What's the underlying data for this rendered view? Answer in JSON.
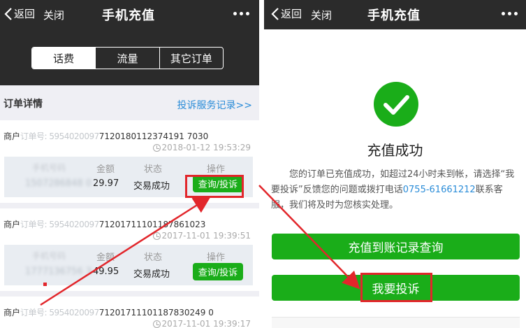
{
  "left": {
    "nav": {
      "back": "返回",
      "close": "关闭",
      "title": "手机充值"
    },
    "tabs": [
      "话费",
      "流量",
      "其它订单"
    ],
    "section": {
      "title": "订单详情",
      "link": "投诉服务记录>>"
    },
    "headers": {
      "phone": "手机号码",
      "amount": "金额",
      "status": "状态",
      "op": "操作"
    },
    "orders": [
      {
        "merchant_label": "商户",
        "merchant_masked": "订单号:  5954020097",
        "order_suffix": "712018011237419170 30",
        "order_no_visible": "7120180112374191 7030",
        "time": "2018-01-12 19:53:29",
        "phone_masked": "1507286848 0",
        "amount": "29.97",
        "status": "交易成功",
        "action": "查询/投诉"
      },
      {
        "merchant_label": "商户",
        "merchant_masked": "订单号:  5954020097",
        "order_no_visible": "71201711101187861023",
        "time": "2017-11-01 19:39:51",
        "phone_masked": "1777136756 3",
        "amount": "49.95",
        "status": "交易成功",
        "action": "查询/投诉"
      },
      {
        "merchant_label": "商户",
        "merchant_masked": "订单号:  5954020097",
        "order_no_visible": "71201711101187830249 0",
        "time": "2017-11-01 19:39:17"
      }
    ]
  },
  "right": {
    "nav": {
      "back": "返回",
      "close": "关闭",
      "title": "手机充值"
    },
    "success_title": "充值成功",
    "desc_part1": "您的订单已充值成功，如超过24小时未到帐，请选择“我要投诉”反馈您的问题或拨打电话",
    "phone": "0755-61661212",
    "desc_part2": "联系客服，我们将及时为您核实处理。",
    "btn_query": "充值到账记录查询",
    "btn_complain": "我要投诉"
  },
  "colors": {
    "green": "#1aad19",
    "red": "#e2262b",
    "link": "#2a8cd8",
    "nav": "#2b2b2b"
  }
}
